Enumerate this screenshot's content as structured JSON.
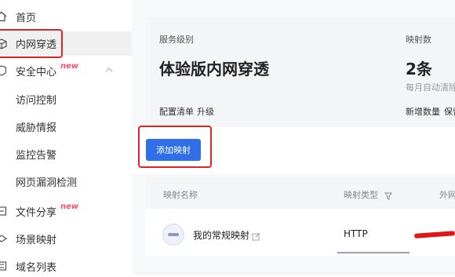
{
  "sidebar": {
    "items": [
      {
        "label": "首页",
        "icon": "home-icon"
      },
      {
        "label": "内网穿透",
        "icon": "box-icon"
      },
      {
        "label": "安全中心",
        "icon": "shield-icon",
        "badge": "new"
      },
      {
        "label": "访问控制"
      },
      {
        "label": "威胁情报"
      },
      {
        "label": "监控告警"
      },
      {
        "label": "网页漏洞检测"
      },
      {
        "label": "文件分享",
        "icon": "file-share-icon",
        "badge": "new"
      },
      {
        "label": "场景映射",
        "icon": "scene-icon"
      },
      {
        "label": "域名列表",
        "icon": "domain-icon"
      }
    ]
  },
  "service": {
    "level_label": "服务级别",
    "level_value": "体验版内网穿透",
    "config_link": "配置清单",
    "upgrade_link": "升级",
    "mapping_label": "映射数",
    "mapping_value": "2条",
    "mapping_note": "每月自动清除",
    "add_quantity_link": "新增数量",
    "keep_link": "保留"
  },
  "toolbar": {
    "add_button": "添加映射"
  },
  "table": {
    "columns": [
      "映射名称",
      "映射类型",
      "外网"
    ],
    "rows": [
      {
        "name": "我的常规映射",
        "type": "HTTP"
      }
    ]
  },
  "colors": {
    "accent": "#2f6fe8",
    "highlight": "#e02424",
    "badge": "#ff4d6a"
  }
}
